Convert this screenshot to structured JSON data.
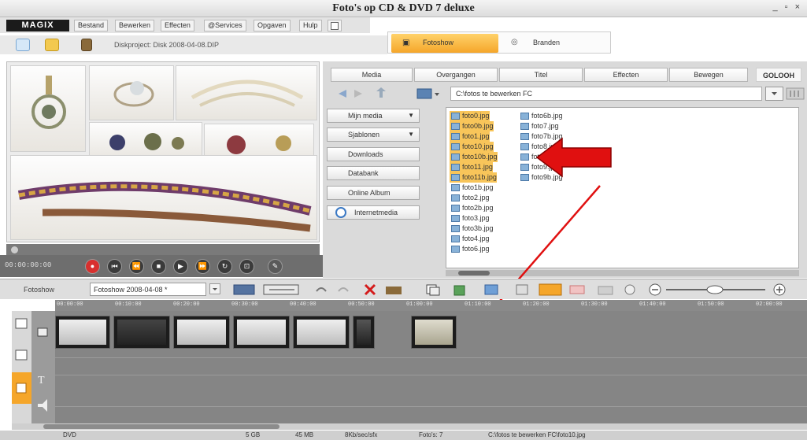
{
  "window": {
    "title": "Foto's op CD & DVD 7 deluxe",
    "controls": "_ ▫ ×"
  },
  "menu": {
    "logo": "MAGIX",
    "items": [
      "Bestand",
      "Bewerken",
      "Effecten",
      "@Services",
      "Opgaven",
      "Hulp"
    ]
  },
  "mode_tabs": {
    "fotoshow": "Fotoshow",
    "branden": "Branden"
  },
  "toolbar": {
    "disk_project": "Diskproject: Disk 2008-04-08.DIP"
  },
  "transport": {
    "timecode": "00:00:00:00"
  },
  "media_tabs": [
    "Media",
    "Overgangen",
    "Titel",
    "Effecten",
    "Bewegen"
  ],
  "media_tab_logo": "GOLOOH",
  "path": "C:\\fotos te bewerken FC",
  "side_buttons": [
    "Mijn media",
    "Sjablonen",
    "Downloads",
    "Databank",
    "Online Album",
    "Internetmedia"
  ],
  "files_col1": [
    "foto0.jpg",
    "foto0b.jpg",
    "foto1.jpg",
    "foto10.jpg",
    "foto10b.jpg",
    "foto11.jpg",
    "foto11b.jpg",
    "foto1b.jpg",
    "foto2.jpg",
    "foto2b.jpg",
    "foto3.jpg",
    "foto3b.jpg",
    "foto4.jpg",
    "foto6.jpg"
  ],
  "files_col2": [
    "foto6b.jpg",
    "foto7.jpg",
    "foto7b.jpg",
    "foto8.jpg",
    "foto8b.jpg",
    "foto9.jpg",
    "foto9b.jpg"
  ],
  "selected_count": 7,
  "story": {
    "label": "Fotoshow",
    "name": "Fotoshow 2008-04-08 *"
  },
  "ruler_ticks": [
    "00:00:00",
    "00:10:00",
    "00:20:00",
    "00:30:00",
    "00:40:00",
    "00:50:00",
    "01:00:00",
    "01:10:00",
    "01:20:00",
    "01:30:00",
    "01:40:00",
    "01:50:00",
    "02:00:00"
  ],
  "status": {
    "media": "DVD",
    "size": "5 GB",
    "used": "45 MB",
    "rate": "8Kb/sec/sfx",
    "photos": "Foto's: 7",
    "file": "C:\\fotos te bewerken FC\\foto10.jpg"
  },
  "colors": {
    "accent": "#f5a62a",
    "arrow": "#e01010",
    "selection": "#f8c55a"
  }
}
